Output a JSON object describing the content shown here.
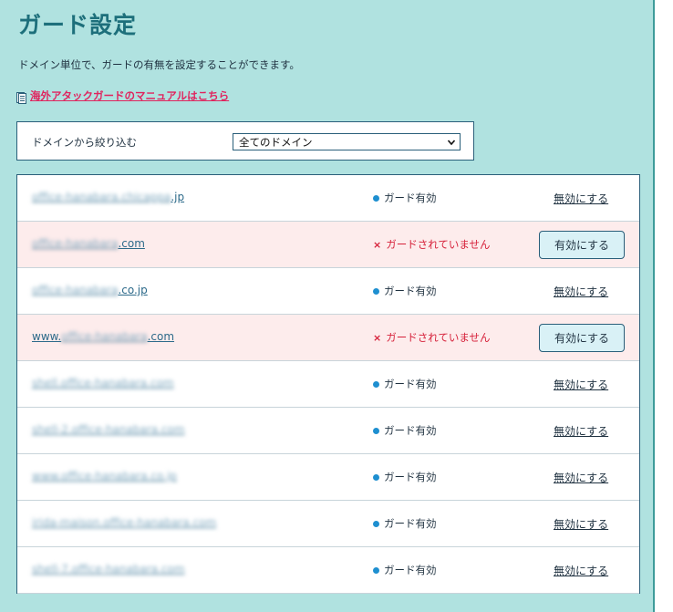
{
  "page": {
    "title": "ガード設定",
    "description": "ドメイン単位で、ガードの有無を設定することができます。",
    "manual_link": "海外アタックガードのマニュアルはこちら"
  },
  "filter": {
    "label": "ドメインから絞り込む",
    "selected": "全てのドメイン"
  },
  "rows": [
    {
      "domain_hidden": "office-hanabara.chicappa",
      "domain_visible": ".jp",
      "status": "ガード有効",
      "action": "無効にする",
      "guarded": true
    },
    {
      "domain_hidden": "office-hanabara",
      "domain_visible": ".com",
      "status": "ガードされていません",
      "action": "有効にする",
      "guarded": false
    },
    {
      "domain_hidden": "office-hanabara",
      "domain_visible": ".co.jp",
      "status": "ガード有効",
      "action": "無効にする",
      "guarded": true
    },
    {
      "domain_prefix": "www.",
      "domain_hidden": "office-hanabara",
      "domain_visible": ".com",
      "status": "ガードされていません",
      "action": "有効にする",
      "guarded": false
    },
    {
      "domain_hidden": "shell.office-hanabara.com",
      "domain_visible": "",
      "status": "ガード有効",
      "action": "無効にする",
      "guarded": true
    },
    {
      "domain_hidden": "shell-2.office-hanabara.com",
      "domain_visible": "",
      "status": "ガード有効",
      "action": "無効にする",
      "guarded": true
    },
    {
      "domain_hidden": "www.office-hanabara.co.jp",
      "domain_visible": "",
      "status": "ガード有効",
      "action": "無効にする",
      "guarded": true
    },
    {
      "domain_hidden": "irida-maison.office-hanabara.com",
      "domain_visible": "",
      "status": "ガード有効",
      "action": "無効にする",
      "guarded": true
    },
    {
      "domain_hidden": "shell-7.office-hanabara.com",
      "domain_visible": "",
      "status": "ガード有効",
      "action": "無効にする",
      "guarded": true
    }
  ]
}
